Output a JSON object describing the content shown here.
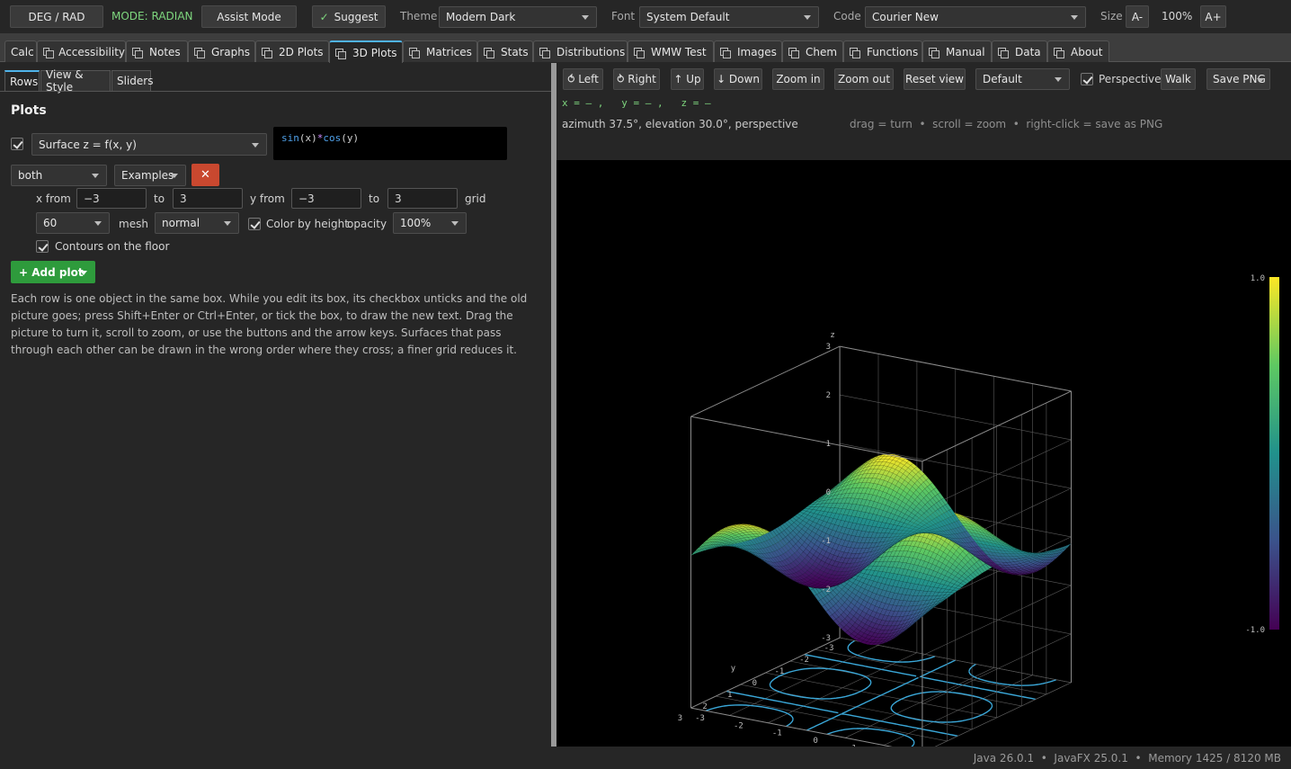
{
  "toolbar": {
    "deg_rad": "DEG / RAD",
    "mode": "MODE: RADIAN",
    "assist": "Assist Mode",
    "suggest_check": "✓",
    "suggest": "Suggest",
    "theme_label": "Theme",
    "theme_value": "Modern Dark",
    "font_label": "Font",
    "font_value": "System Default",
    "code_label": "Code",
    "code_value": "Courier New",
    "size_label": "Size",
    "size_minus": "A-",
    "size_value": "100%",
    "size_plus": "A+"
  },
  "tabs": [
    "Calc",
    "Accessibility",
    "Notes",
    "Graphs",
    "2D Plots",
    "3D Plots",
    "Matrices",
    "Stats",
    "Distributions",
    "WMW Test",
    "Images",
    "Chem",
    "Functions",
    "Manual",
    "Data",
    "About"
  ],
  "subtabs": [
    "Rows",
    "View & Style",
    "Sliders"
  ],
  "plots": {
    "heading": "Plots",
    "type_value": "Surface z = f(x, y)",
    "expr_parts": [
      "sin",
      "(x)",
      "*",
      "cos",
      "(y)"
    ],
    "mode_value": "both",
    "examples": "Examples",
    "delete_glyph": "✕",
    "x_from_label": "x from",
    "x_from": "−3",
    "to1": "to",
    "x_to": "3",
    "y_from_label": "y from",
    "y_from": "−3",
    "to2": "to",
    "y_to": "3",
    "grid_label": "grid",
    "grid_value": "60",
    "mesh_label": "mesh",
    "mesh_value": "normal",
    "color_by_height": "Color by height",
    "opacity_label": "opacity",
    "opacity_value": "100%",
    "contours": "Contours on the floor",
    "add_plot": "+ Add plot",
    "description": "Each row is one object in the same box. While you edit its box, its checkbox unticks and the old picture goes; press Shift+Enter or Ctrl+Enter, or tick the box, to draw the new text. Drag the picture to turn it, scroll to zoom, or use the buttons and the arrow keys. Surfaces that pass through each other can be drawn in the wrong order where they cross; a finer grid reduces it."
  },
  "view": {
    "left": "⥀ Left",
    "right": "⥁ Right",
    "up": "↑ Up",
    "down": "↓ Down",
    "zoom_in": "Zoom in",
    "zoom_out": "Zoom out",
    "reset": "Reset view",
    "preset": "Default",
    "perspective": "Perspective",
    "walk": "Walk",
    "save_png": "Save PNG",
    "coords": "x = — ,   y = — ,   z = —",
    "camera": "azimuth 37.5°, elevation 30.0°, perspective",
    "hints": "drag = turn  •  scroll = zoom  •  right-click = save as PNG"
  },
  "chart_data": {
    "type": "surface",
    "function": "sin(x)*cos(y)",
    "xlim": [
      -3,
      3
    ],
    "ylim": [
      -3,
      3
    ],
    "zlim": [
      -3,
      3
    ],
    "azimuth": 37.5,
    "elevation": 30.0,
    "x_ticks": [
      "-3",
      "-2",
      "-1",
      "0",
      "1",
      "2",
      "3"
    ],
    "y_ticks": [
      "-3",
      "-2",
      "-1",
      "0",
      "1",
      "2",
      "3"
    ],
    "z_ticks": [
      "3",
      "2",
      "1",
      "0",
      "-1",
      "-2",
      "-3"
    ],
    "x_axis_label": "x",
    "y_axis_label": "y",
    "z_axis_label": "z",
    "colorbar": {
      "max": "1.0",
      "min": "-1.0",
      "colormap": "viridis"
    },
    "contour_color": "#3aa7d8"
  },
  "status": "Java 26.0.1  •  JavaFX 25.0.1  •  Memory 1425 / 8120 MB"
}
